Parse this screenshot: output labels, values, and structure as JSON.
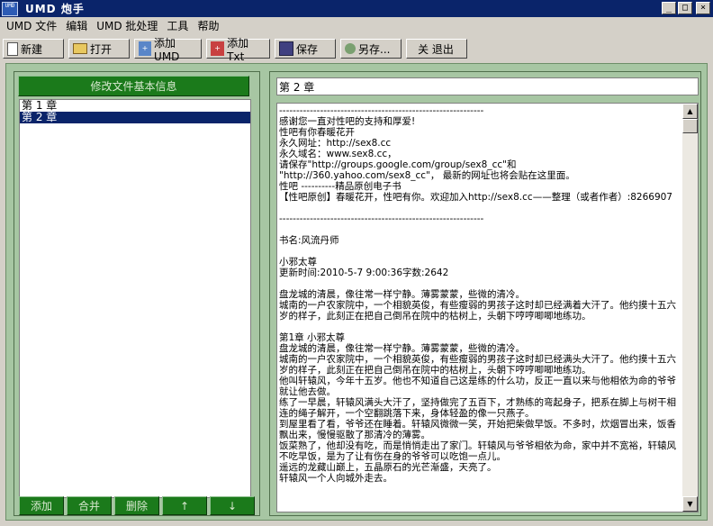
{
  "window": {
    "icon_text": "UMD",
    "title": "UMD 炮手",
    "minimize": "_",
    "maximize": "□",
    "close": "×"
  },
  "menu": [
    "UMD 文件",
    "编辑",
    "UMD 批处理",
    "工具",
    "帮助"
  ],
  "toolbar": {
    "new": "新建",
    "open": "打开",
    "add_umd": "添加UMD",
    "add_txt": "添加Txt",
    "save": "保存",
    "save_as": "另存...",
    "exit": "关 退出"
  },
  "left": {
    "edit_info_button": "修改文件基本信息",
    "chapters": [
      {
        "label": "第 1 章",
        "selected": false
      },
      {
        "label": "第 2 章",
        "selected": true
      }
    ],
    "buttons": {
      "add": "添加",
      "merge": "合并",
      "delete": "删除",
      "up": "↑",
      "down": "↓"
    }
  },
  "right": {
    "chapter_title": "第 2 章",
    "content": "------------------------------------------------------------\n感谢您一直对性吧的支持和厚爱!\n性吧有你春暖花开\n永久网址：http://sex8.cc\n永久域名：www.sex8.cc，\n请保存\"http://groups.google.com/group/sex8_cc\"和\n\"http://360.yahoo.com/sex8_cc\"， 最新的网址也将会贴在这里面。\n性吧 ----------精品原创电子书\n【性吧原创】春暖花开，性吧有你。欢迎加入http://sex8.cc——整理（或者作者）:8266907\n\n------------------------------------------------------------\n\n书名:风流丹师\n\n小邪太尊\n更新时间:2010-5-7 9:00:36字数:2642\n\n盘龙城的清晨，像往常一样宁静。薄雾蒙蒙，些微的清冷。\n城南的一户农家院中，一个相貌英俊，有些瘦弱的男孩子这时却已经满着大汗了。他约摸十五六岁的样子，此刻正在把自己倒吊在院中的枯树上，头朝下哼哼唧唧地练功。\n\n第1章 小邪太尊\n盘龙城的清晨，像往常一样宁静。薄雾蒙蒙，些微的清冷。\n城南的一户农家院中，一个相貌英俊，有些瘦弱的男孩子这时却已经满头大汗了。他约摸十五六岁的样子，此刻正在把自己倒吊在院中的枯树上，头朝下哼哼唧唧地练功。\n他叫轩辕风，今年十五岁。他也不知道自己这是练的什么功，反正一直以来与他相依为命的爷爷就让他去做。\n练了一早晨，轩辕风满头大汗了，坚持做完了五百下，才熟练的弯起身子，把系在脚上与树干相连的绳子解开，一个空翻跳落下来，身体轻盈的像一只燕子。\n到屋里看了看，爷爷还在睡着。轩辕风微微一笑，开始把柴做早饭。不多时，炊烟冒出来，饭香飘出来，慢慢驱散了那清冷的薄雾。\n饭菜熟了，他却没有吃，而是悄悄走出了家门。轩辕风与爷爷相依为命，家中并不宽裕，轩辕风不吃早饭，是为了让有伤在身的爷爷可以吃饱一点儿。\n遥远的龙藏山巅上，五晶原石的光芒渐盛，天亮了。\n轩辕风一个人向城外走去。",
    "scroll_up": "▲",
    "scroll_down": "▼"
  }
}
